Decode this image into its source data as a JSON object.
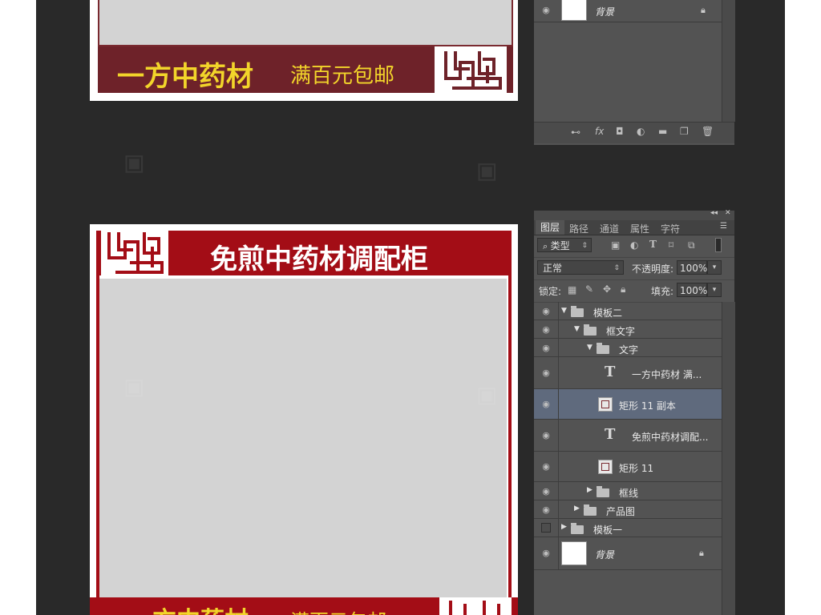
{
  "template_top": {
    "big_text": "一方中药材",
    "small_text": "满百元包邮"
  },
  "template_bottom": {
    "title": "免煎中药材调配柜",
    "big_text": "一方中药材",
    "small_text": "满百元包邮"
  },
  "ps_top": {
    "bg_layer_name": "背景"
  },
  "ps_bottom": {
    "tabs": [
      "图层",
      "路径",
      "通道",
      "属性",
      "字符"
    ],
    "filter_label": "类型",
    "blend_mode": "正常",
    "opacity_label": "不透明度:",
    "opacity_value": "100%",
    "lock_label": "锁定:",
    "fill_label": "填充:",
    "fill_value": "100%",
    "layers": [
      {
        "name": "模板二"
      },
      {
        "name": "框文字"
      },
      {
        "name": "文字"
      },
      {
        "name": "一方中药材 满..."
      },
      {
        "name": "矩形 11 副本"
      },
      {
        "name": "免煎中药材调配..."
      },
      {
        "name": "矩形 11"
      },
      {
        "name": "框线"
      },
      {
        "name": "产品图"
      },
      {
        "name": "模板一"
      },
      {
        "name": "背景"
      }
    ]
  },
  "icons": {
    "eye": "eye-icon",
    "lock": "lock-icon",
    "folder": "folder-icon",
    "text_layer": "text-layer-icon"
  },
  "colors": {
    "brand_red": "#a30d16",
    "maroon": "#6e2229",
    "gold": "#f2d52a",
    "panel_bg": "#535353",
    "selected_row": "#5f6a7d"
  }
}
